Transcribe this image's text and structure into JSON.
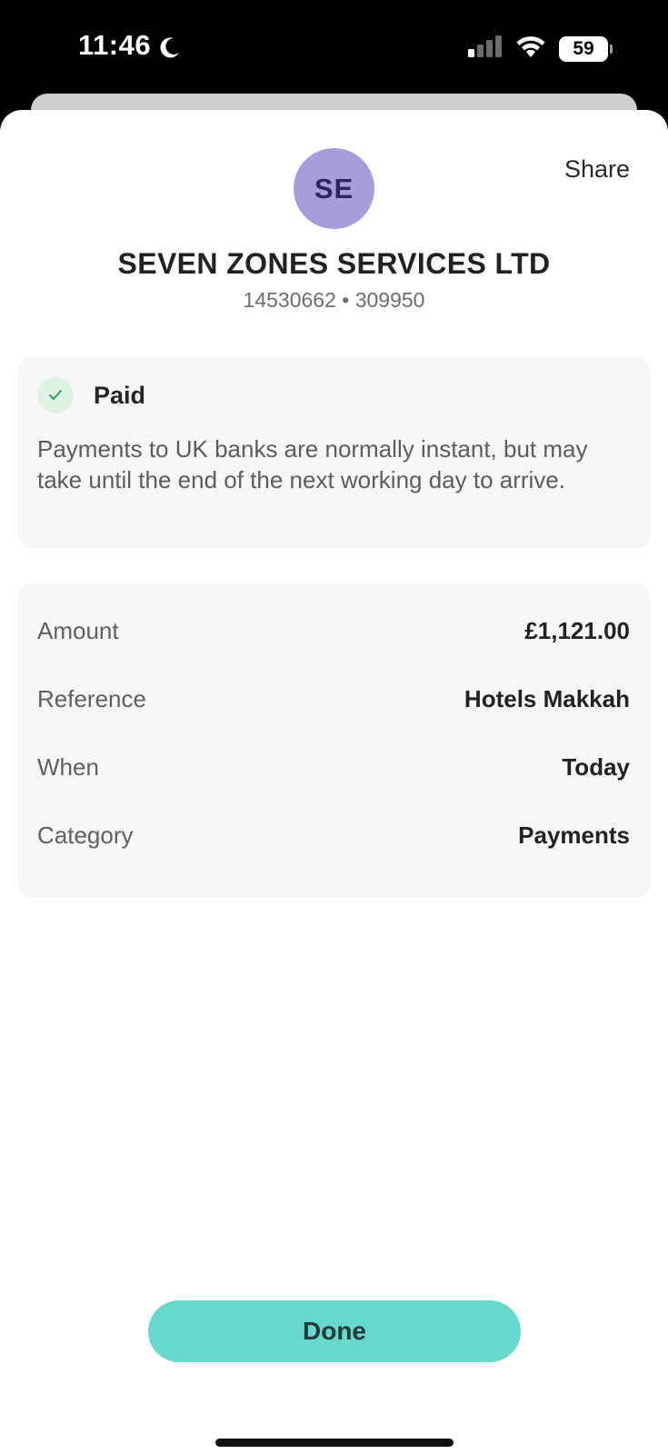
{
  "status_bar": {
    "time": "11:46",
    "battery": "59",
    "icons": [
      "moon-icon",
      "signal-icon",
      "wifi-icon",
      "battery-icon"
    ]
  },
  "header": {
    "share_label": "Share",
    "avatar_initials": "SE",
    "payee_name": "SEVEN ZONES SERVICES LTD",
    "account_info": "14530662 • 309950"
  },
  "status": {
    "label": "Paid",
    "message": "Payments to UK banks are normally instant, but may take until the end of the next working day to arrive."
  },
  "details": [
    {
      "label": "Amount",
      "value": "£1,121.00"
    },
    {
      "label": "Reference",
      "value": "Hotels Makkah"
    },
    {
      "label": "When",
      "value": "Today"
    },
    {
      "label": "Category",
      "value": "Payments"
    }
  ],
  "footer": {
    "done_label": "Done"
  },
  "colors": {
    "accent": "#66d8cc",
    "avatar_bg": "#a89cdc",
    "paid_check": "#2e9e5b"
  }
}
